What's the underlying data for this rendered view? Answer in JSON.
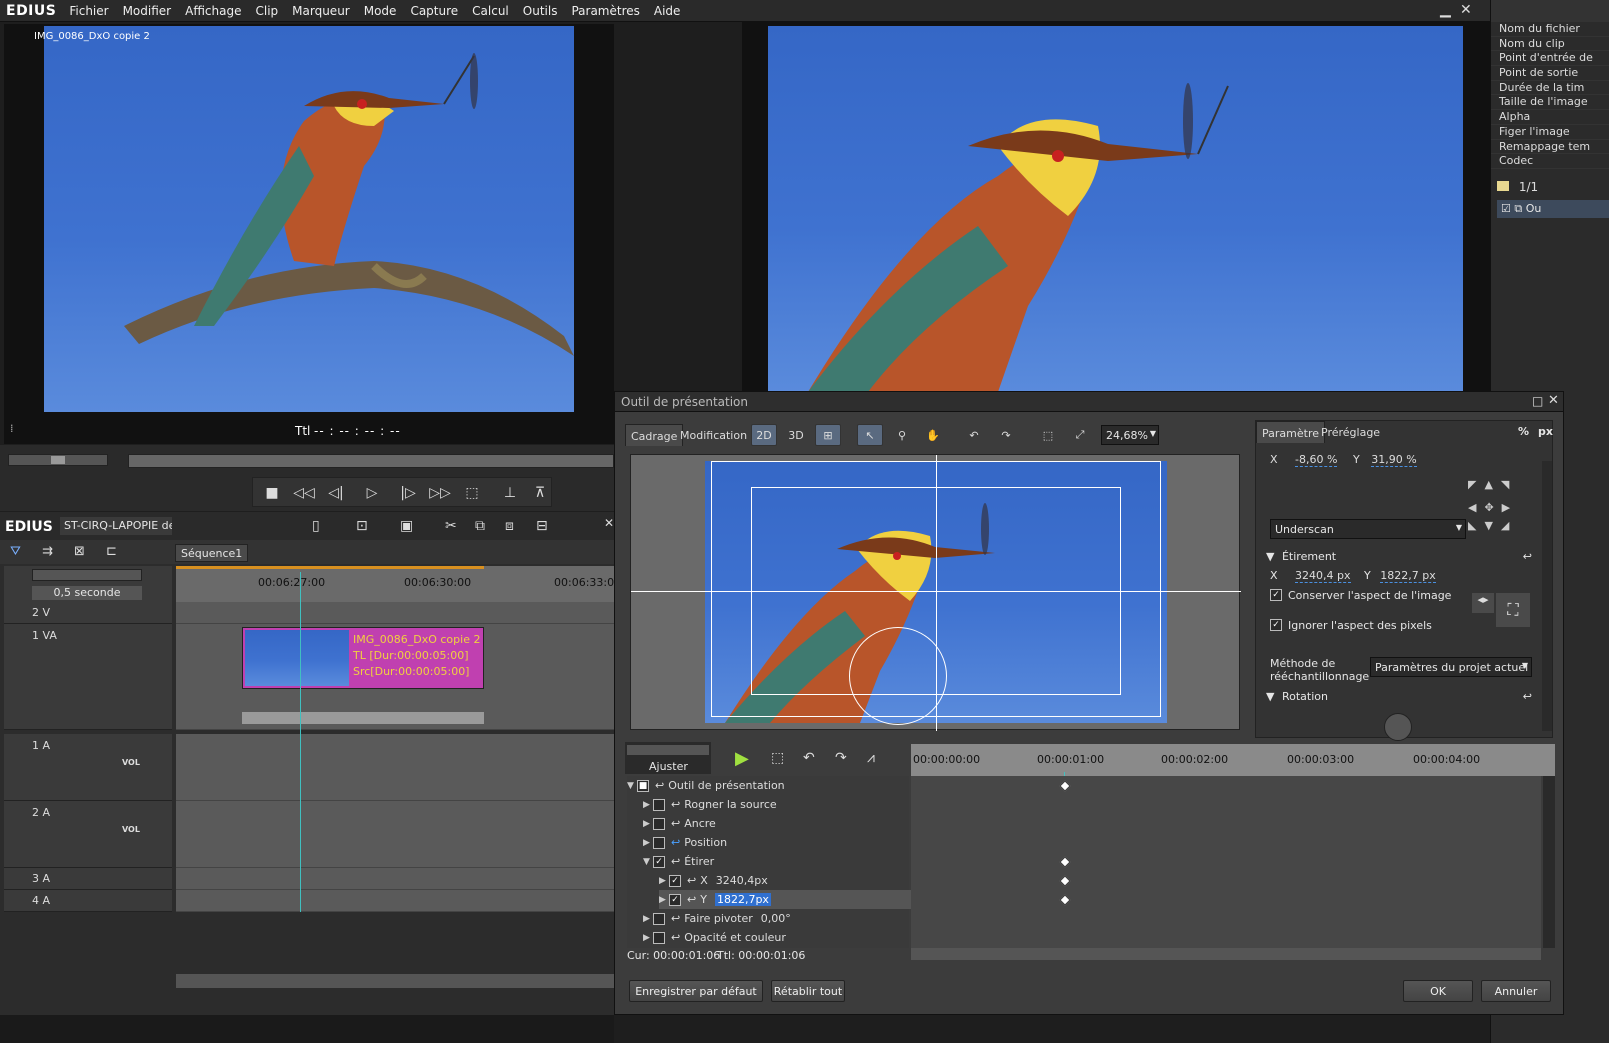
{
  "app": {
    "logo": "EDIUS"
  },
  "menu": [
    "Fichier",
    "Modifier",
    "Affichage",
    "Clip",
    "Marqueur",
    "Mode",
    "Capture",
    "Calcul",
    "Outils",
    "Paramètres",
    "Aide"
  ],
  "player": {
    "clip_name": "IMG_0086_DxO copie 2",
    "tc_label": "Ttl",
    "timecode": "-- : -- : -- : --"
  },
  "properties": {
    "rows": [
      "Nom du fichier",
      "Nom du clip",
      "Point d'entrée de",
      "Point de sortie",
      "Durée de la tim",
      "Taille de l'image",
      "Alpha",
      "Figer l'image",
      "Remappage tem",
      "Codec"
    ],
    "counter": "1/1",
    "item_label": "Ou"
  },
  "timeline": {
    "logo": "EDIUS",
    "project": "ST-CIRQ-LAPOPIE der",
    "sequence_tab": "Séquence1",
    "scale": "0,5 seconde",
    "ruler": [
      "00:06:27:00",
      "00:06:30:00",
      "00:06:33:00"
    ],
    "tracks": {
      "v2": "2 V",
      "va1": "1 VA",
      "a1": "1 A",
      "a2": "2 A",
      "a3": "3 A",
      "a4": "4 A",
      "vol": "VOL"
    },
    "clip": {
      "name": "IMG_0086_DxO copie 2",
      "tl": "TL [Dur:00:00:05:00]",
      "src": "Src[Dur:00:00:05:00]"
    }
  },
  "dialog": {
    "title": "Outil de présentation",
    "tabs": [
      "Cadrage",
      "Modification"
    ],
    "toolbar": {
      "b2d": "2D",
      "b3d": "3D",
      "zoom": "24,68%"
    },
    "right_tabs": [
      "Paramètre",
      "Préréglage"
    ],
    "units": {
      "pct": "%",
      "px": "px"
    },
    "position": {
      "x_label": "X",
      "x": "-8,60 %",
      "y_label": "Y",
      "y": "31,90 %"
    },
    "underscan": "Underscan",
    "stretch": {
      "title": "Étirement",
      "x_label": "X",
      "x": "3240,4 px",
      "y_label": "Y",
      "y": "1822,7 px"
    },
    "keep_aspect": "Conserver l'aspect de l'image",
    "ignore_pixel": "Ignorer l'aspect des pixels",
    "resample_label": "Méthode de rééchantillonnage",
    "resample_value": "Paramètres du projet actuel",
    "rotation": "Rotation",
    "fit": "Ajuster",
    "kf_ruler": [
      "00:00:00:00",
      "00:00:01:00",
      "00:00:02:00",
      "00:00:03:00",
      "00:00:04:00"
    ],
    "kf_rows": [
      {
        "label": "Outil de présentation",
        "value": ""
      },
      {
        "label": "Rogner la source",
        "value": ""
      },
      {
        "label": "Ancre",
        "value": ""
      },
      {
        "label": "Position",
        "value": ""
      },
      {
        "label": "Étirer",
        "value": ""
      },
      {
        "label": "X",
        "value": "3240,4px"
      },
      {
        "label": "Y",
        "value": "1822,7px"
      },
      {
        "label": "Faire pivoter",
        "value": "0,00°"
      },
      {
        "label": "Opacité et couleur",
        "value": ""
      }
    ],
    "cur": "Cur: 00:00:01:06",
    "ttl": "Ttl: 00:00:01:06",
    "save_default": "Enregistrer par défaut",
    "reset_all": "Rétablir tout",
    "ok": "OK",
    "cancel": "Annuler"
  }
}
